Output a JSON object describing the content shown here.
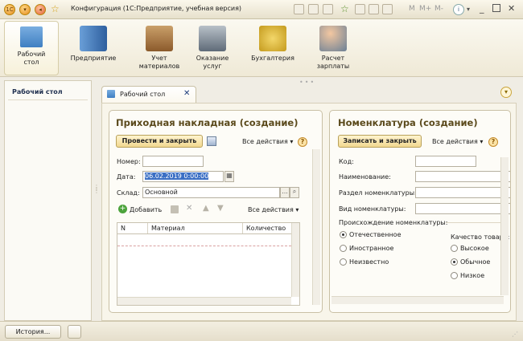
{
  "window": {
    "title": "Конфигурация  (1С:Предприятие, учебная версия)",
    "right_letters": [
      "M",
      "M+",
      "M-"
    ],
    "icons": [
      "logo-icon",
      "menu-icon",
      "back-icon",
      "star-icon"
    ]
  },
  "sections": [
    {
      "label": "Рабочий\nстол",
      "icon": "desktop-icon"
    },
    {
      "label": "Предприятие",
      "icon": "building-icon"
    },
    {
      "label": "Учет\nматериалов",
      "icon": "boxes-icon"
    },
    {
      "label": "Оказание\nуслуг",
      "icon": "register-icon"
    },
    {
      "label": "Бухгалтерия",
      "icon": "coins-icon"
    },
    {
      "label": "Расчет\nзарплаты",
      "icon": "people-icon"
    }
  ],
  "left_panel": {
    "header": "Рабочий стол"
  },
  "tab": {
    "label": "Рабочий стол",
    "close": "✕"
  },
  "form1": {
    "title": "Приходная накладная (создание)",
    "post_close_btn": "Провести и закрыть",
    "all_actions": "Все действия",
    "number_label": "Номер:",
    "number_value": "",
    "date_label": "Дата:",
    "date_value": "06.02.2019  0:00:00",
    "warehouse_label": "Склад:",
    "warehouse_value": "Основной",
    "add_btn": "Добавить",
    "table_actions": "Все действия",
    "columns": [
      "N",
      "Материал",
      "Количество"
    ]
  },
  "form2": {
    "title": "Номенклатура (создание)",
    "write_close_btn": "Записать и закрыть",
    "all_actions": "Все действия",
    "code_label": "Код:",
    "name_label": "Наименование:",
    "section_label": "Раздел номенклатуры:",
    "kind_label": "Вид номенклатуры:",
    "origin_label": "Происхождение номенклатуры:",
    "origin_options": [
      "Отечественное",
      "Иностранное",
      "Неизвестно"
    ],
    "origin_selected": 0,
    "quality_label": "Качество товара:",
    "quality_options": [
      "Высокое",
      "Обычное",
      "Низкое"
    ],
    "quality_selected": 1
  },
  "bottom": {
    "history_btn": "История..."
  },
  "colors": {
    "accent": "#5b4a1c",
    "button": "#f2d890",
    "selection": "#3b6fc4"
  }
}
